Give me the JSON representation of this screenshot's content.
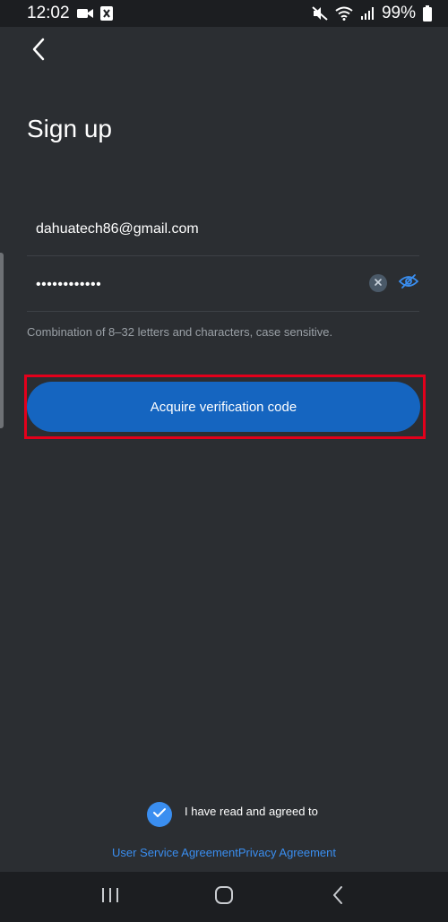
{
  "status_bar": {
    "time": "12:02",
    "battery": "99%",
    "icons": [
      "video-camera-icon",
      "app-notification-icon",
      "mute-icon",
      "wifi-icon",
      "signal-icon",
      "battery-icon"
    ]
  },
  "header": {
    "back_icon": "chevron-left-icon",
    "title": "Sign up"
  },
  "form": {
    "email_value": "dahuatech86@gmail.com",
    "password_masked": "••••••••••••",
    "clear_icon": "clear-icon",
    "visibility_icon": "eye-off-icon",
    "hint": "Combination of 8–32 letters and characters, case sensitive."
  },
  "primary_button": {
    "label": "Acquire verification code"
  },
  "agreement": {
    "checked": true,
    "text": "I have read and agreed to",
    "user_service_link": "User Service Agreement",
    "privacy_link": "Privacy Agreement"
  },
  "nav_bar": {
    "icons": [
      "recent-apps-icon",
      "home-icon",
      "back-icon"
    ]
  },
  "colors": {
    "background": "#2b2e32",
    "accent": "#1565c0",
    "link": "#3a8ef0",
    "highlight": "#e3001b"
  }
}
